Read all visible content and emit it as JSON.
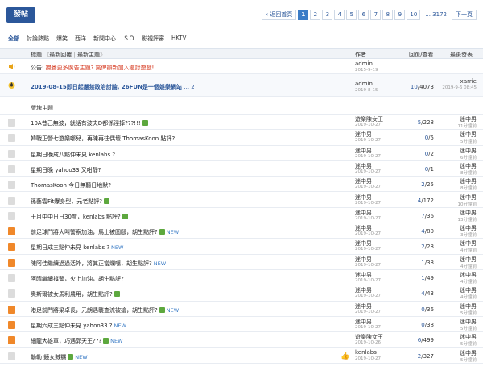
{
  "toolbar": {
    "post_label": "發帖"
  },
  "pager": {
    "back_label": "返回首頁",
    "pages": [
      "1",
      "2",
      "3",
      "4",
      "5",
      "6",
      "7",
      "8",
      "9",
      "10",
      "... 3172"
    ],
    "current": "1",
    "next_label": "下一頁"
  },
  "categories": [
    "全部",
    "討論熱點",
    "爆笑",
    "西洋",
    "新聞中心",
    "ＳＯ",
    "影視評審",
    "HKTV"
  ],
  "header": {
    "title_label": "標題",
    "sort_new_reply": "最新回覆",
    "sort_new_topic": "最新主題",
    "author_label": "作者",
    "stats_label": "回復/查看",
    "last_label": "最後發表"
  },
  "announcement": {
    "prefix": "公告:",
    "title": "攪番更多廣告主題? 識俾辦新加入獵討遊戲!",
    "author": "admin",
    "date": "2015-9-19"
  },
  "sticky": {
    "title": "2019-08-15即日起嚴禁政治討論, 26FUN是一個娛樂網站",
    "pages": "... 2",
    "author": "admin",
    "date": "2019-8-15",
    "replies": "10",
    "views": "4073",
    "last_name": "xarrie",
    "last_time": "2019-9-6 08:45"
  },
  "section_label": "版塊主題",
  "rows": [
    {
      "title": "10A昔己無波，就話有波夫D都係淫掉???!!!",
      "att": true,
      "new": false,
      "author": "遊樂陳女王",
      "date": "2019-10-27",
      "replies": "5",
      "views": "228",
      "last_name": "迷中男",
      "last_time": "11分鐘前",
      "icon": "doc"
    },
    {
      "title": "韓戰正營七遊樂哪兒，再陳再往偶壇 ThomasKoon 點評?",
      "att": false,
      "new": false,
      "author": "迷中男",
      "date": "2019-10-27",
      "replies": "0",
      "views": "5",
      "last_name": "迷中男",
      "last_time": "5分鐘前",
      "icon": "doc"
    },
    {
      "title": "星期日晚成八點仲未見 kenlabs ?",
      "att": false,
      "new": false,
      "author": "迷中男",
      "date": "2019-10-27",
      "replies": "0",
      "views": "2",
      "last_name": "迷中男",
      "last_time": "6分鐘前",
      "icon": "doc"
    },
    {
      "title": "星期日晚 yahoo33 又咁靜?",
      "att": false,
      "new": false,
      "author": "迷中男",
      "date": "2019-10-27",
      "replies": "0",
      "views": "1",
      "last_name": "迷中男",
      "last_time": "8分鐘前",
      "icon": "doc"
    },
    {
      "title": "ThomasKoon 今日無聽日地默?",
      "att": false,
      "new": false,
      "author": "迷中男",
      "date": "2019-10-27",
      "replies": "2",
      "views": "25",
      "last_name": "迷中男",
      "last_time": "8分鐘前",
      "icon": "doc"
    },
    {
      "title": "孫藝雲Fit爆身型，元老點評?",
      "att": true,
      "new": false,
      "author": "迷中男",
      "date": "2019-10-27",
      "replies": "4",
      "views": "172",
      "last_name": "迷中男",
      "last_time": "10分鐘前",
      "icon": "doc"
    },
    {
      "title": "十月中中日日30度，kenlabs 點評?",
      "att": true,
      "new": false,
      "author": "迷中男",
      "date": "2019-10-27",
      "replies": "7",
      "views": "36",
      "last_name": "迷中男",
      "last_time": "13分鐘前",
      "icon": "doc"
    },
    {
      "title": "前足球門將大叫警察加油，馬上被圍毆，胡生點評?",
      "att": true,
      "new": true,
      "author": "迷中男",
      "date": "2019-10-27",
      "replies": "4",
      "views": "80",
      "last_name": "迷中男",
      "last_time": "3分鐘前",
      "icon": "hot"
    },
    {
      "title": "星期日成三點仲未見 kenlabs ?",
      "att": false,
      "new": true,
      "author": "迷中男",
      "date": "2019-10-27",
      "replies": "2",
      "views": "28",
      "last_name": "迷中男",
      "last_time": "4分鐘前",
      "icon": "hot"
    },
    {
      "title": "陳阿佳繼續過過活外，將其正當爛嘴，胡生點評?",
      "att": false,
      "new": true,
      "author": "迷中男",
      "date": "2019-10-27",
      "replies": "1",
      "views": "38",
      "last_name": "迷中男",
      "last_time": "4分鐘前",
      "icon": "hot"
    },
    {
      "title": "阿晴繼續撐警，火上加油，胡生點評?",
      "att": false,
      "new": false,
      "author": "迷中男",
      "date": "2019-10-27",
      "replies": "1",
      "views": "49",
      "last_name": "迷中男",
      "last_time": "4分鐘前",
      "icon": "doc"
    },
    {
      "title": "奧斯爾被女馬利農用，胡生點評?",
      "att": true,
      "new": false,
      "author": "迷中男",
      "date": "2019-10-27",
      "replies": "4",
      "views": "43",
      "last_name": "迷中男",
      "last_time": "4分鐘前",
      "icon": "doc"
    },
    {
      "title": "港足前門將梁卓長，元朗遇襲查流被搶，胡生點評?",
      "att": true,
      "new": true,
      "author": "迷中男",
      "date": "2019-10-27",
      "replies": "0",
      "views": "36",
      "last_name": "迷中男",
      "last_time": "5分鐘前",
      "icon": "hot"
    },
    {
      "title": "星期六成三點仲未見 yahoo33 ?",
      "att": false,
      "new": true,
      "author": "迷中男",
      "date": "2019-10-27",
      "replies": "0",
      "views": "38",
      "last_name": "迷中男",
      "last_time": "5分鐘前",
      "icon": "hot"
    },
    {
      "title": "細龍大雄軍，巧遇郭天王???",
      "att": true,
      "new": true,
      "author": "遊樂陳女王",
      "date": "2019-10-26",
      "replies": "6",
      "views": "499",
      "last_name": "迷中男",
      "last_time": "5分鐘前",
      "icon": "hot"
    },
    {
      "title": "勒勒 鏡女賊嬲",
      "att": true,
      "new": true,
      "author": "kenlabs",
      "date": "2019-10-27",
      "replies": "2",
      "views": "327",
      "last_name": "迷中男",
      "last_time": "5分鐘前",
      "icon": "doc",
      "thumb": true
    }
  ]
}
